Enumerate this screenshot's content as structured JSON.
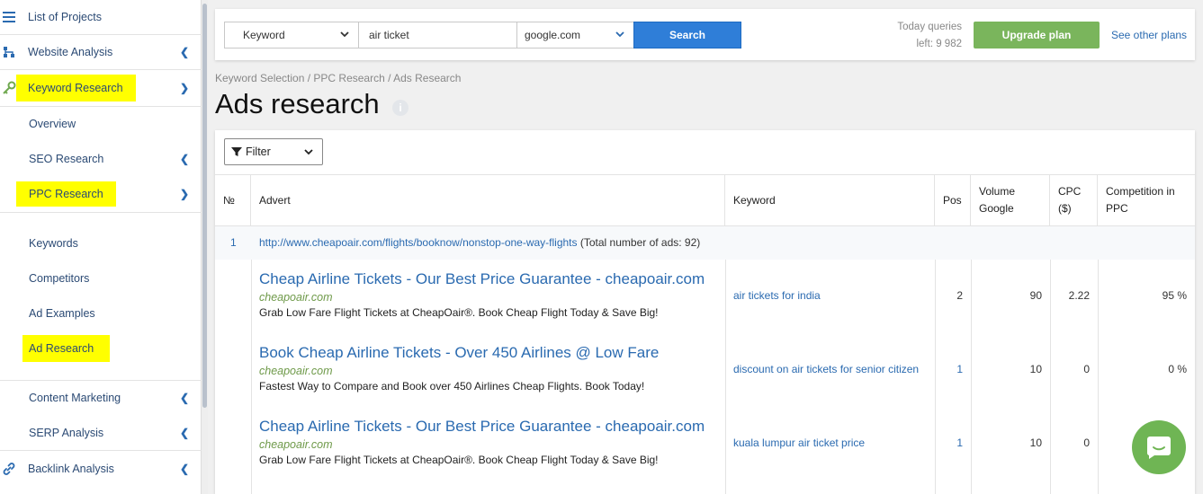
{
  "sidebar": {
    "list_projects": "List of Projects",
    "website_analysis": "Website Analysis",
    "keyword_research": "Keyword Research",
    "overview": "Overview",
    "seo_research": "SEO Research",
    "ppc_research": "PPC Research",
    "keywords": "Keywords",
    "competitors": "Competitors",
    "ad_examples": "Ad Examples",
    "ad_research": "Ad Research",
    "content_marketing": "Content Marketing",
    "serp_analysis": "SERP Analysis",
    "backlink_analysis": "Backlink Analysis",
    "highlight_color": "#ffff00",
    "accent_color": "#2a6ab0"
  },
  "search": {
    "mode": "Keyword",
    "query": "air ticket",
    "engine": "google.com",
    "button": "Search"
  },
  "account": {
    "queries_line1": "Today queries",
    "queries_line2": "left: 9 982",
    "upgrade": "Upgrade plan",
    "other_plans": "See other plans"
  },
  "breadcrumb": "Keyword Selection / PPC Research / Ads Research",
  "page_title": "Ads research",
  "filter_label": "Filter",
  "table": {
    "headers": {
      "num": "№",
      "advert": "Advert",
      "keyword": "Keyword",
      "pos": "Pos",
      "volume_1": "Volume",
      "volume_2": "Google",
      "cpc_1": "CPC",
      "cpc_2": "($)",
      "comp_1": "Competition in",
      "comp_2": "PPC"
    },
    "group": {
      "num": "1",
      "url": "http://www.cheapoair.com/flights/booknow/nonstop-one-way-flights",
      "total": "(Total number of ads: 92)"
    },
    "rows": [
      {
        "title": "Cheap Airline Tickets - Our Best Price Guarantee - cheapoair.com",
        "domain": "cheapoair.com",
        "desc": "Grab Low Fare Flight Tickets at CheapOair®. Book Cheap Flight Today & Save Big!",
        "keyword": "air tickets for india",
        "pos": "2",
        "volume": "90",
        "cpc": "2.22",
        "competition": "95 %"
      },
      {
        "title": "Book Cheap Airline Tickets - Over 450 Airlines @ Low Fare",
        "domain": "cheapoair.com",
        "desc": "Fastest Way to Compare and Book over 450 Airlines Cheap Flights. Book Today!",
        "keyword": "discount on air tickets for senior citizen",
        "pos": "1",
        "volume": "10",
        "cpc": "0",
        "competition": "0 %"
      },
      {
        "title": "Cheap Airline Tickets - Our Best Price Guarantee - cheapoair.com",
        "domain": "cheapoair.com",
        "desc": "Grab Low Fare Flight Tickets at CheapOair®. Book Cheap Flight Today & Save Big!",
        "keyword": "kuala lumpur air ticket price",
        "pos": "1",
        "volume": "10",
        "cpc": "0",
        "competition": ""
      }
    ]
  }
}
